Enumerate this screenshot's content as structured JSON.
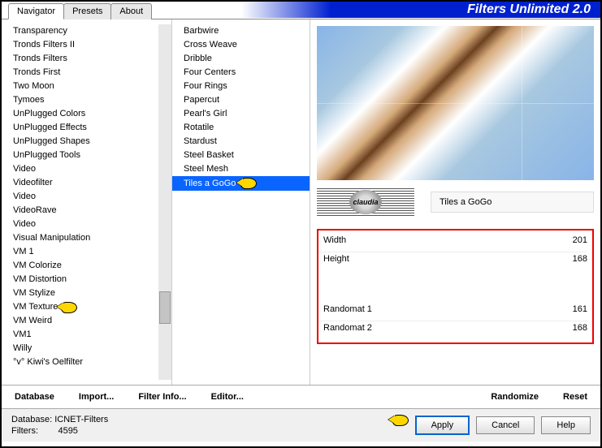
{
  "app_title": "Filters Unlimited 2.0",
  "tabs": [
    "Navigator",
    "Presets",
    "About"
  ],
  "active_tab": 0,
  "categories": [
    "Transparency",
    "Tronds Filters II",
    "Tronds Filters",
    "Tronds First",
    "Two Moon",
    "Tymoes",
    "UnPlugged Colors",
    "UnPlugged Effects",
    "UnPlugged Shapes",
    "UnPlugged Tools",
    "Video",
    "Videofilter",
    "Video",
    "VideoRave",
    "Video",
    "Visual Manipulation",
    "VM 1",
    "VM Colorize",
    "VM Distortion",
    "VM Stylize",
    "VM Texture",
    "VM Weird",
    "VM1",
    "Willy",
    "°v° Kiwi's Oelfilter"
  ],
  "selected_category": "VM Texture",
  "filters": [
    "Barbwire",
    "Cross Weave",
    "Dribble",
    "Four Centers",
    "Four Rings",
    "Papercut",
    "Pearl's Girl",
    "Rotatile",
    "Stardust",
    "Steel Basket",
    "Steel Mesh",
    "Tiles a GoGo"
  ],
  "selected_filter_index": 11,
  "current_filter_name": "Tiles a GoGo",
  "watermark_text": "claudia",
  "params": [
    {
      "label": "Width",
      "value": "201"
    },
    {
      "label": "Height",
      "value": "168"
    }
  ],
  "params2": [
    {
      "label": "Randomat 1",
      "value": "161"
    },
    {
      "label": "Randomat 2",
      "value": "168"
    }
  ],
  "toolbar": {
    "database": "Database",
    "import": "Import...",
    "filter_info": "Filter Info...",
    "editor": "Editor...",
    "randomize": "Randomize",
    "reset": "Reset"
  },
  "footer": {
    "db_label": "Database:",
    "db_value": "ICNET-Filters",
    "filters_label": "Filters:",
    "filters_value": "4595",
    "apply": "Apply",
    "cancel": "Cancel",
    "help": "Help"
  }
}
